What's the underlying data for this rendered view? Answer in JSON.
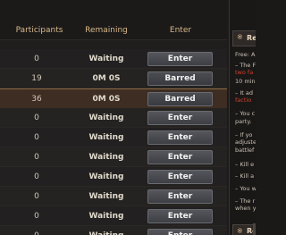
{
  "table": {
    "headers": {
      "participants": "Participants",
      "remaining": "Remaining",
      "enter": "Enter"
    },
    "rows": [
      {
        "participants": "0",
        "remaining": "Waiting",
        "button": "Enter",
        "state": "partial"
      },
      {
        "participants": "19",
        "remaining": "0M 0S",
        "button": "Barred",
        "state": "normal"
      },
      {
        "participants": "36",
        "remaining": "0M 0S",
        "button": "Barred",
        "state": "highlighted"
      },
      {
        "participants": "0",
        "remaining": "Waiting",
        "button": "Enter",
        "state": "normal"
      },
      {
        "participants": "0",
        "remaining": "Waiting",
        "button": "Enter",
        "state": "normal"
      },
      {
        "participants": "0",
        "remaining": "Waiting",
        "button": "Enter",
        "state": "normal"
      },
      {
        "participants": "0",
        "remaining": "Waiting",
        "button": "Enter",
        "state": "normal"
      },
      {
        "participants": "0",
        "remaining": "Waiting",
        "button": "Enter",
        "state": "normal"
      },
      {
        "participants": "0",
        "remaining": "Waiting",
        "button": "Enter",
        "state": "normal"
      },
      {
        "participants": "0",
        "remaining": "Waiting",
        "button": "Enter",
        "state": "partial"
      }
    ]
  },
  "panel": {
    "header_icon": "※",
    "header_title": "Re",
    "lines": [
      {
        "text": "Free: A",
        "color": "normal"
      },
      {
        "text": "– The F",
        "color": "normal"
      },
      {
        "text": "two fa",
        "color": "red"
      },
      {
        "text": "10 min",
        "color": "normal"
      },
      {
        "text": "– It ad",
        "color": "normal"
      },
      {
        "text": "factio",
        "color": "red"
      },
      {
        "text": "– You c",
        "color": "normal"
      },
      {
        "text": "party.",
        "color": "normal"
      },
      {
        "text": "– If yo",
        "color": "normal"
      },
      {
        "text": "adjuste",
        "color": "normal"
      },
      {
        "text": "battlef",
        "color": "normal"
      },
      {
        "text": "– Kill e",
        "color": "normal"
      },
      {
        "text": "– Kill a",
        "color": "normal"
      },
      {
        "text": "– You w",
        "color": "normal"
      },
      {
        "text": "– The r",
        "color": "normal"
      },
      {
        "text": "when y",
        "color": "normal"
      }
    ],
    "footer_icon": "※",
    "footer_title": "Re"
  },
  "colors": {
    "header_text": "#d9b88a",
    "highlight_row": "#3d2d22",
    "red_text": "#d2402c",
    "button": "#4a4b50"
  }
}
